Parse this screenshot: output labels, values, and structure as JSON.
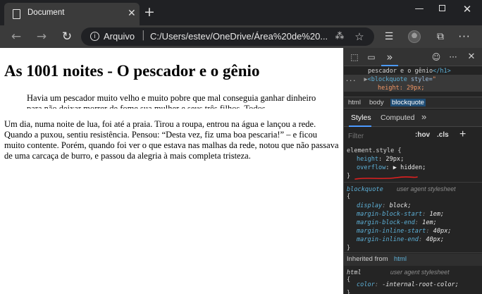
{
  "browser": {
    "tab_title": "Document",
    "tab_close": "✕",
    "new_tab": "+",
    "window_controls": {
      "minimize": "—",
      "close": "✕"
    },
    "address": {
      "scheme_label": "Arquivo",
      "separator": "|",
      "url": "C:/Users/estev/OneDrive/Área%20de%20..."
    },
    "icons": [
      "document-icon",
      "back-icon",
      "forward-icon",
      "refresh-icon",
      "info-icon",
      "read-aloud-icon",
      "star-icon",
      "favorites-icon",
      "profile-icon",
      "collections-icon",
      "more-icon"
    ]
  },
  "page": {
    "heading": "As 1001 noites - O pescador e o gênio",
    "blockquote": "Havia um pescador muito velho e muito pobre que mal conseguia ganhar dinheiro para não deixar morrer de fome sua mulher e seus três filhos. Todos",
    "paragraph": "Um dia, numa noite de lua, foi até a praia. Tirou a roupa, entrou na água e lançou a rede. Quando a puxou, sentiu resistência. Pensou: “Desta vez, fiz uma boa pescaria!” – e ficou muito contente. Porém, quando foi ver o que estava nas malhas da rede, notou que não passava de uma carcaça de burro, e passou da alegria à mais completa tristeza."
  },
  "devtools": {
    "panels_label": "»",
    "dom": {
      "line1_text": "pescador e o gênio",
      "line1_close": "</h1>",
      "line2_prefix": "...",
      "line2_arrow": "▶",
      "line2_tag": "<blockquote",
      "line2_attr": " style=",
      "line2_val": "\"",
      "line3_val": "height: 29px;"
    },
    "breadcrumbs": [
      "html",
      "body",
      "blockquote"
    ],
    "subtabs": {
      "styles": "Styles",
      "computed": "Computed",
      "more": "»"
    },
    "filter": {
      "placeholder": "Filter",
      "hov": ":hov",
      "cls": ".cls",
      "plus": "+"
    },
    "element_style": {
      "selector": "element.style {",
      "height_prop": "height",
      "height_val": "29px;",
      "overflow_prop": "overflow",
      "overflow_arrow": "▶",
      "overflow_val": "hidden;",
      "close": "}"
    },
    "blockquote_rule": {
      "selector": "blockquote",
      "source": "user agent stylesheet",
      "open": "{",
      "props": [
        {
          "name": "display",
          "value": "block;"
        },
        {
          "name": "margin-block-start",
          "value": "1em;"
        },
        {
          "name": "margin-block-end",
          "value": "1em;"
        },
        {
          "name": "margin-inline-start",
          "value": "40px;"
        },
        {
          "name": "margin-inline-end",
          "value": "40px;"
        }
      ],
      "close": "}"
    },
    "inherited": {
      "label": "Inherited from",
      "from": "html"
    },
    "html_rule": {
      "selector": "html",
      "source": "user agent stylesheet",
      "open": "{",
      "prop": "color",
      "value": "-internal-root-color;",
      "close": "}"
    },
    "accent_colors": {
      "selection": "#1f4d75",
      "tab_underline": "#4c9aff",
      "annotation": "#e02020"
    }
  }
}
